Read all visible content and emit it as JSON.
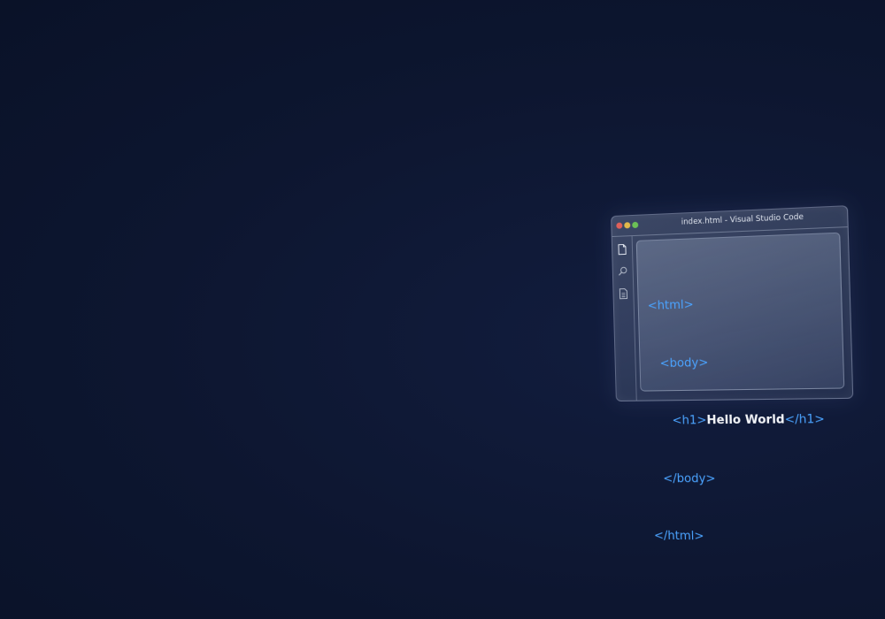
{
  "window": {
    "title": "index.html - Visual Studio Code"
  },
  "activity_bar": {
    "icons": [
      "files-icon",
      "search-icon",
      "document-icon"
    ]
  },
  "editor": {
    "lines": [
      {
        "open": "<html>"
      },
      {
        "open": "<body>"
      },
      {
        "open": "<h1>",
        "text": "Hello World",
        "close": "</h1>"
      },
      {
        "open": "</body>"
      },
      {
        "open": "</html>"
      }
    ]
  },
  "colors": {
    "background": "#0d1630",
    "tag": "#4aa3ff",
    "text": "#f2f4f8",
    "close_dot": "#e0605a",
    "minimize_dot": "#e2b84a",
    "maximize_dot": "#6cc156"
  }
}
